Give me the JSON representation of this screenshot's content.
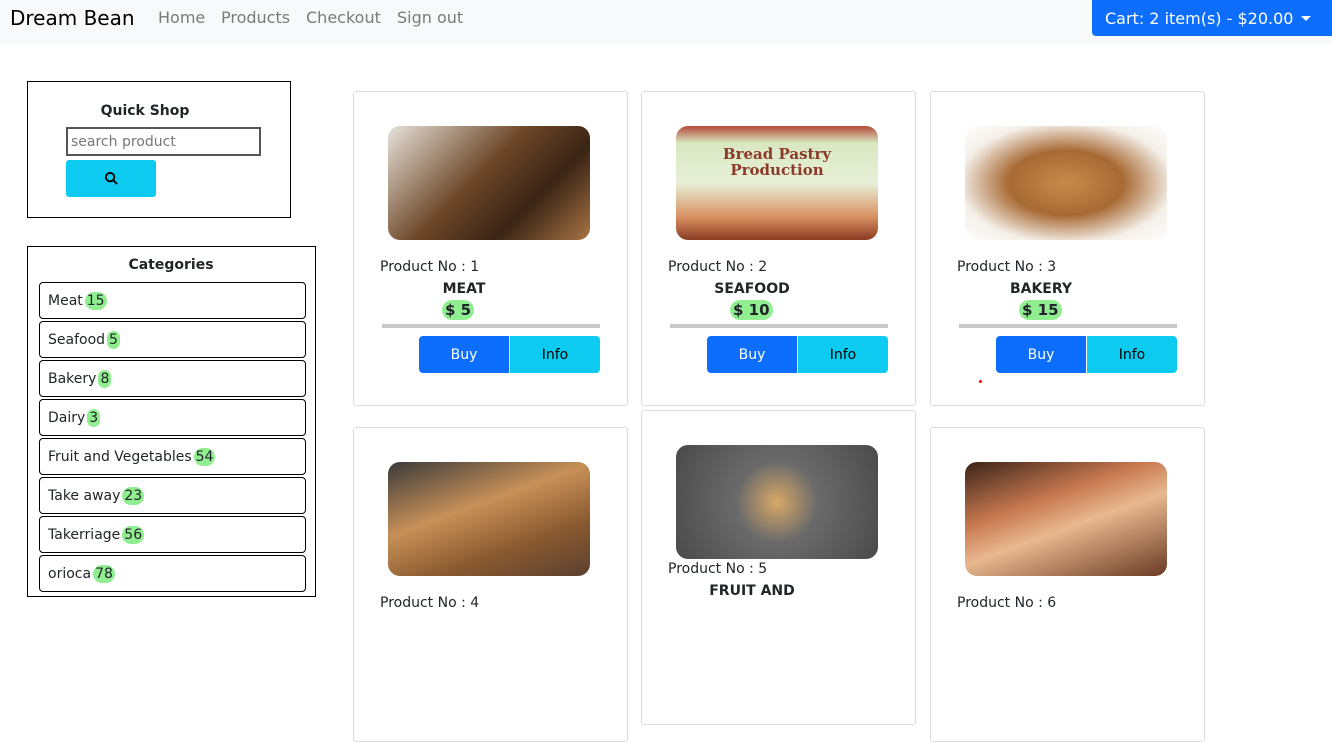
{
  "nav": {
    "brand": "Dream Bean",
    "links": [
      "Home",
      "Products",
      "Checkout",
      "Sign out"
    ],
    "cart": "Cart: 2 item(s) - $20.00"
  },
  "quick_shop": {
    "title": "Quick Shop",
    "placeholder": "search product",
    "search_icon": "search-icon"
  },
  "categories": {
    "title": "Categories",
    "items": [
      {
        "label": "Meat",
        "count": "15"
      },
      {
        "label": "Seafood",
        "count": "5"
      },
      {
        "label": "Bakery",
        "count": "8"
      },
      {
        "label": "Dairy",
        "count": "3"
      },
      {
        "label": "Fruit and Vegetables",
        "count": "54"
      },
      {
        "label": "Take away",
        "count": "23"
      },
      {
        "label": "Takerriage",
        "count": "56"
      },
      {
        "label": "orioca",
        "count": "78"
      }
    ]
  },
  "products": [
    {
      "no": "Product No : 1",
      "name": "MEAT",
      "price": "$ 5",
      "buy": "Buy",
      "info": "Info"
    },
    {
      "no": "Product No : 2",
      "name": "SEAFOOD",
      "price": "$ 10",
      "buy": "Buy",
      "info": "Info",
      "image_text": "Bread Pastry Production"
    },
    {
      "no": "Product No : 3",
      "name": "BAKERY",
      "price": "$ 15",
      "buy": "Buy",
      "info": "Info"
    },
    {
      "no": "Product No : 4"
    },
    {
      "no": "Product No : 5",
      "name": "FRUIT AND"
    },
    {
      "no": "Product No : 6"
    }
  ],
  "colors": {
    "primary": "#0d6efd",
    "info": "#0dcaf0",
    "badge": "#90ee90"
  }
}
